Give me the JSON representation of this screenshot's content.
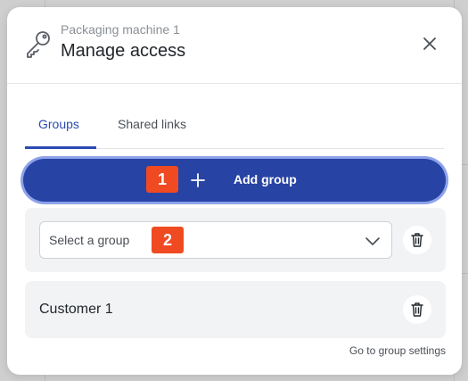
{
  "header": {
    "subtitle": "Packaging machine 1",
    "title": "Manage access"
  },
  "tabs": [
    {
      "label": "Groups",
      "active": true
    },
    {
      "label": "Shared links",
      "active": false
    }
  ],
  "add_group": {
    "label": "Add group"
  },
  "group_select": {
    "placeholder": "Select a group"
  },
  "groups": [
    {
      "name": "Customer 1"
    }
  ],
  "footer": {
    "link": "Go to group settings"
  },
  "annotations": [
    "1",
    "2"
  ],
  "icons": {
    "key": "key-icon",
    "close": "close-icon",
    "plus": "plus-icon",
    "chevron": "chevron-down-icon",
    "trash": "trash-icon"
  },
  "colors": {
    "accent": "#2743a4",
    "accent_ring": "#8ea2ea",
    "badge": "#ef4a22",
    "card_bg": "#f2f3f5"
  }
}
